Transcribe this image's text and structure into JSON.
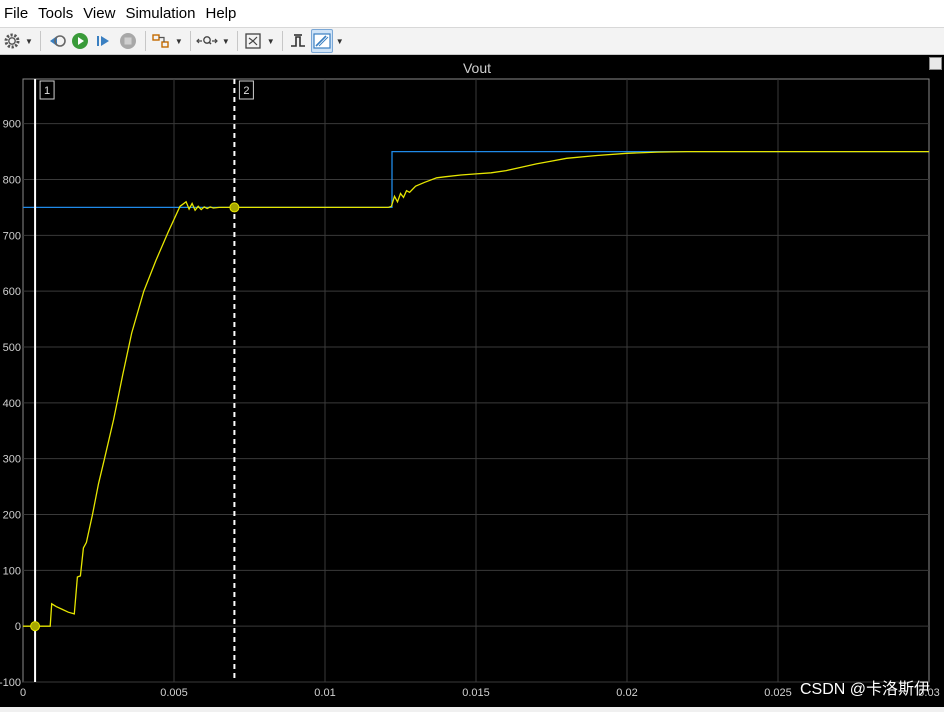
{
  "menu": {
    "items": [
      "File",
      "Tools",
      "View",
      "Simulation",
      "Help"
    ]
  },
  "toolbar": {
    "buttons": [
      {
        "name": "settings-gear-icon",
        "active": false
      },
      {
        "name": "step-back-icon",
        "active": false
      },
      {
        "name": "run-icon",
        "active": false
      },
      {
        "name": "step-forward-icon",
        "active": false
      },
      {
        "name": "stop-icon",
        "active": false
      },
      {
        "name": "highlight-block-icon",
        "active": false
      },
      {
        "name": "zoom-icon",
        "active": false
      },
      {
        "name": "autoscale-icon",
        "active": false
      },
      {
        "name": "triggers-icon",
        "active": false
      },
      {
        "name": "cursor-measurements-icon",
        "active": true
      }
    ]
  },
  "scope": {
    "title": "Vout",
    "background": "#000000",
    "grid_color": "#3a3a3a",
    "axis_text_color": "#d0d0d0"
  },
  "cursors": [
    {
      "label": "1",
      "x": 0.0004,
      "style": "solid",
      "color": "#ffffff",
      "marker_y": 0
    },
    {
      "label": "2",
      "x": 0.007,
      "style": "dashed",
      "color": "#ffffff",
      "marker_y": 750
    }
  ],
  "chart_data": {
    "type": "line",
    "title": "Vout",
    "xlabel": "",
    "ylabel": "",
    "xlim": [
      0,
      0.03
    ],
    "ylim": [
      -100,
      980
    ],
    "grid": true,
    "x_ticks": [
      0,
      0.005,
      0.01,
      0.015,
      0.02,
      0.025,
      0.03
    ],
    "x_tick_labels": [
      "0",
      "0.005",
      "0.01",
      "0.015",
      "0.02",
      "0.025",
      "0.03"
    ],
    "y_ticks": [
      -100,
      0,
      100,
      200,
      300,
      400,
      500,
      600,
      700,
      800,
      900
    ],
    "y_tick_labels": [
      "-100",
      "0",
      "100",
      "200",
      "300",
      "400",
      "500",
      "600",
      "700",
      "800",
      "900"
    ],
    "series": [
      {
        "color": "#1f8ae8",
        "x": [
          0,
          0.01222,
          0.01222,
          0.03
        ],
        "y": [
          750,
          750,
          850,
          850
        ]
      },
      {
        "color": "#e6e600",
        "x": [
          0,
          0.0009,
          0.00095,
          0.0011,
          0.0013,
          0.0015,
          0.0017,
          0.0018,
          0.0019,
          0.002,
          0.0021,
          0.0023,
          0.0025,
          0.0027,
          0.003,
          0.0033,
          0.0036,
          0.004,
          0.0044,
          0.0048,
          0.0052,
          0.0054,
          0.0055,
          0.0056,
          0.0057,
          0.0058,
          0.0059,
          0.006,
          0.0061,
          0.0062,
          0.0063,
          0.0065,
          0.0068,
          0.007,
          0.009,
          0.011,
          0.0121,
          0.0122,
          0.0123,
          0.0124,
          0.0125,
          0.0126,
          0.0127,
          0.0128,
          0.013,
          0.0133,
          0.0137,
          0.014,
          0.0145,
          0.015,
          0.0155,
          0.016,
          0.0165,
          0.017,
          0.0175,
          0.018,
          0.019,
          0.02,
          0.021,
          0.022,
          0.023,
          0.025,
          0.03
        ],
        "y": [
          0,
          0,
          40,
          35,
          30,
          25,
          22,
          88,
          90,
          140,
          150,
          200,
          255,
          300,
          370,
          450,
          525,
          600,
          655,
          705,
          752,
          760,
          747,
          757,
          745,
          752,
          746,
          751,
          748,
          751,
          749,
          750,
          750,
          750,
          750,
          750,
          750,
          752,
          770,
          760,
          775,
          768,
          780,
          777,
          788,
          795,
          803,
          805,
          808,
          810,
          812,
          816,
          822,
          828,
          833,
          838,
          843,
          847,
          849,
          850,
          850,
          850,
          850
        ]
      }
    ]
  },
  "watermark": "CSDN @卡洛斯伊"
}
